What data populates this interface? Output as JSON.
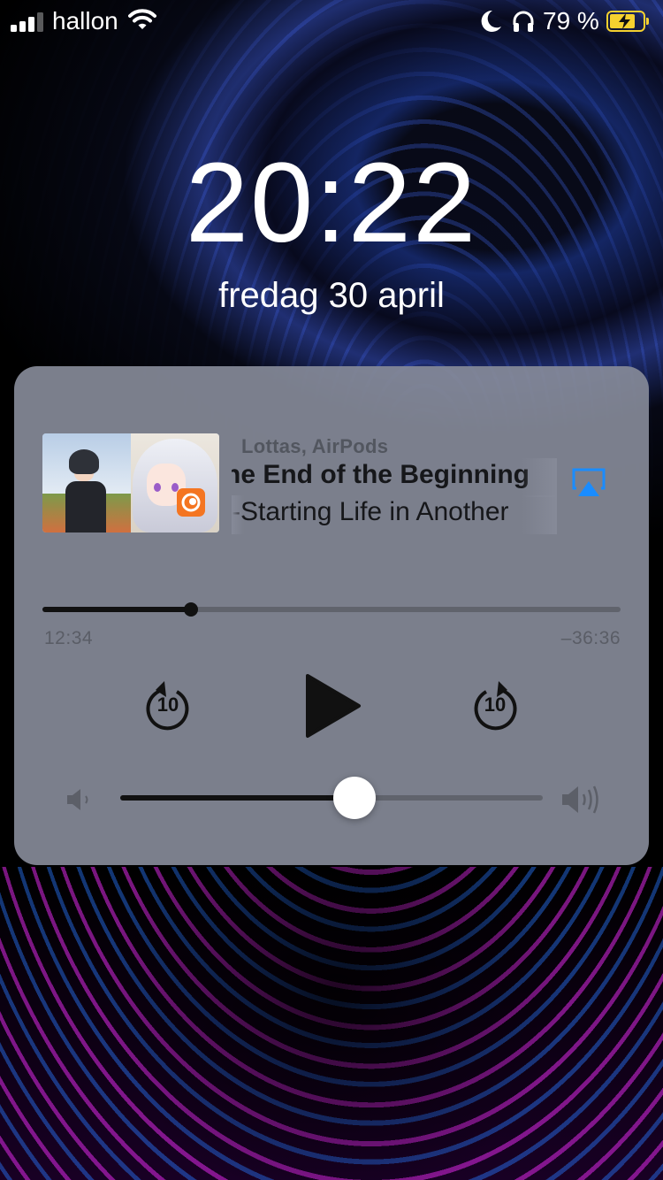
{
  "status_bar": {
    "carrier": "hallon",
    "battery_percent": "79 %",
    "battery_level": 0.79,
    "icons": [
      "cellular-signal-icon",
      "wifi-icon",
      "moon-icon",
      "headphones-icon",
      "battery-charging-icon"
    ]
  },
  "lock_screen": {
    "time": "20:22",
    "date": "fredag 30 april"
  },
  "now_playing": {
    "devices": "Lottas, AirPods",
    "title": "he End of the Beginning",
    "subtitle": "-Starting Life in Another",
    "elapsed": "12:34",
    "remaining": "–36:36",
    "progress": 0.257,
    "volume": 0.555,
    "skip_back_seconds": "10",
    "skip_forward_seconds": "10",
    "colors": {
      "airplay_accent": "#1a8cff",
      "badge": "#f47521",
      "battery": "#f5d12f"
    }
  }
}
